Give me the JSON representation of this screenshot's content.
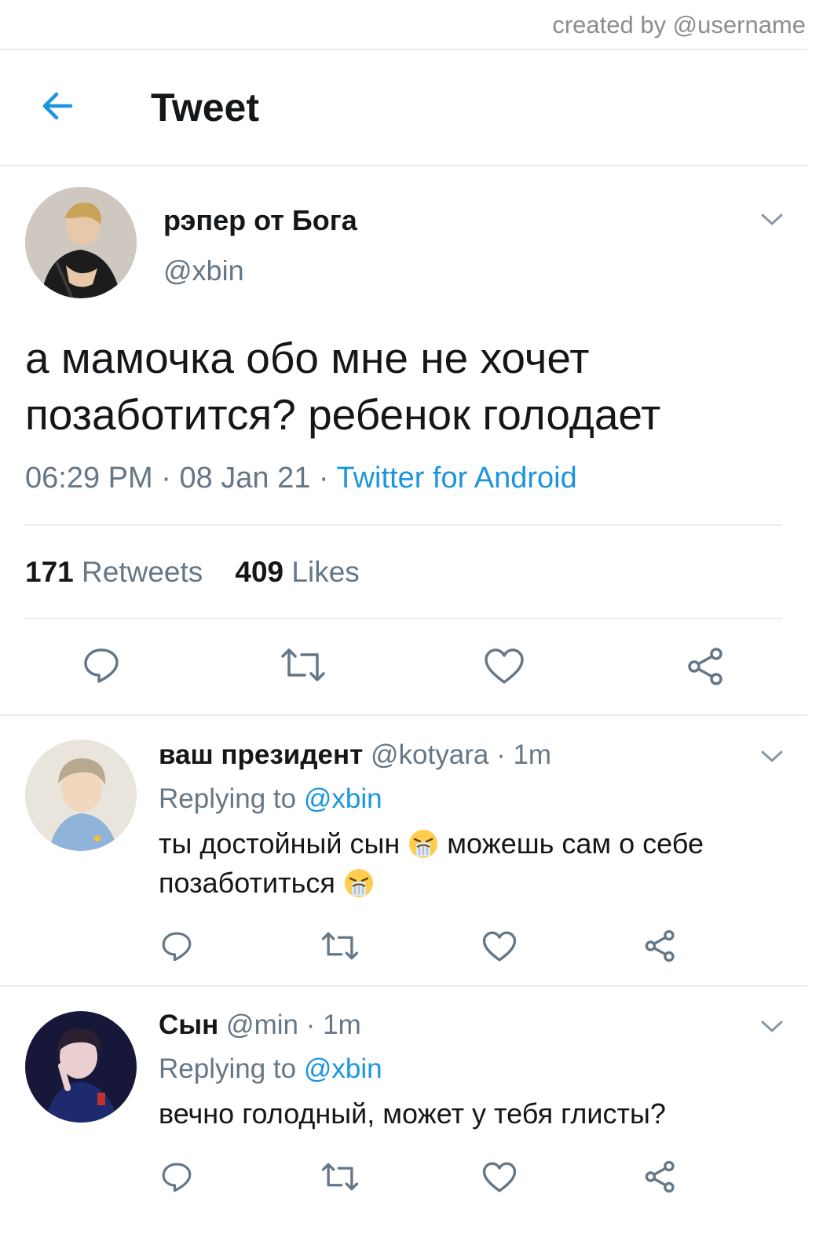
{
  "credit": "created by @username",
  "header": {
    "title": "Tweet",
    "back_icon": "arrow-left-icon"
  },
  "colors": {
    "accent": "#1b95e0",
    "muted": "#657786",
    "divider": "#e6ecf0"
  },
  "tweet": {
    "display_name": "рэпер от Бога",
    "handle": "@xbin",
    "text": "а мамочка обо мне не хочет позаботится? ребенок голодает",
    "time": "06:29 PM",
    "date": "08 Jan 21",
    "source": "Twitter for Android",
    "retweets_count": "171",
    "retweets_label": "Retweets",
    "likes_count": "409",
    "likes_label": "Likes"
  },
  "replies": [
    {
      "display_name": "ваш президент",
      "handle": "@kotyara",
      "time": "1m",
      "replying_label": "Replying to",
      "replying_handle": "@xbin",
      "text_part1": "ты достойный сын",
      "text_part2": "можешь сам о себе позаботиться",
      "emoji": "crying-face"
    },
    {
      "display_name": "Сын",
      "handle": "@min",
      "time": "1m",
      "replying_label": "Replying to",
      "replying_handle": "@xbin",
      "text": "вечно голодный, может у тебя глисты?"
    }
  ],
  "separator": "·"
}
